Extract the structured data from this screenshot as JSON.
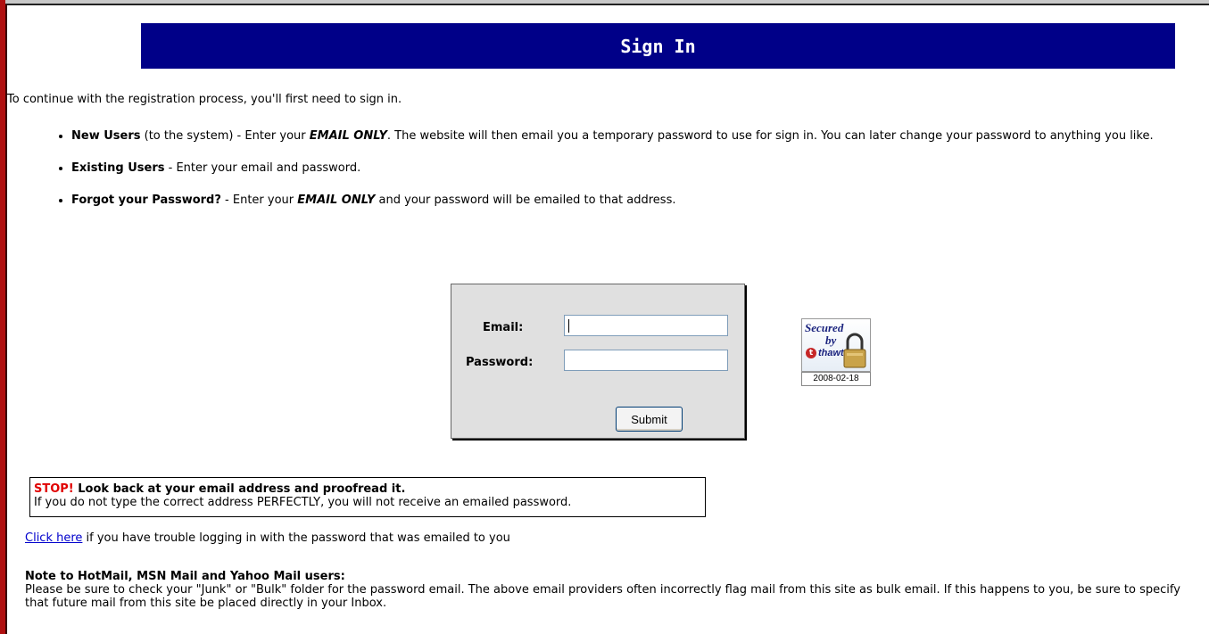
{
  "header": {
    "title": "Sign In"
  },
  "intro": "To continue with the registration process, you'll first need to sign in.",
  "bullets": [
    {
      "term": "New Users",
      "text1": " (to the system) - Enter your ",
      "emph": "EMAIL ONLY",
      "text2": ". The website will then email you a temporary password to use for sign in. You can later change your password to anything you like."
    },
    {
      "term": "Existing Users",
      "text1": " - Enter your email and password.",
      "emph": "",
      "text2": ""
    },
    {
      "term": "Forgot your Password?",
      "text1": " - Enter your ",
      "emph": "EMAIL ONLY",
      "text2": " and your password will be emailed to that address."
    }
  ],
  "login": {
    "email_label": "Email:",
    "email_value": "",
    "password_label": "Password:",
    "password_value": "",
    "submit_label": "Submit"
  },
  "seal": {
    "line1": "Secured",
    "line2": "by",
    "brand": "thawte",
    "date": "2008-02-18"
  },
  "warning": {
    "stop": "STOP!",
    "headline": " Look back at your email address and proofread it.",
    "body": "If you do not type the correct address PERFECTLY, you will not receive an emailed password."
  },
  "trouble": {
    "link": "Click here",
    "text": " if you have trouble logging in with the password that was emailed to you"
  },
  "note": {
    "title": "Note to HotMail, MSN Mail and Yahoo Mail users:",
    "body": "Please be sure to check your \"Junk\" or \"Bulk\" folder for the password email. The above email providers often incorrectly flag mail from this site as bulk email. If this happens to you, be sure to specify that future mail from this site be placed directly in your Inbox."
  }
}
